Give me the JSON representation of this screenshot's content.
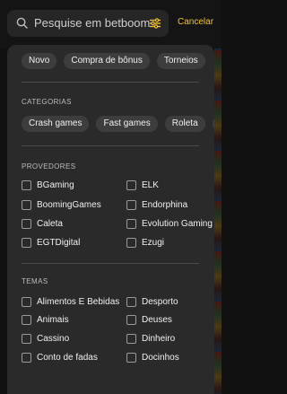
{
  "search": {
    "placeholder": "Pesquise em betboom",
    "cancel_label": "Cancelar"
  },
  "quick_filters": [
    "Novo",
    "Compra de bônus",
    "Torneios"
  ],
  "categories": {
    "title": "CATEGORIAS",
    "items": [
      "Crash games",
      "Fast games",
      "Roleta"
    ]
  },
  "providers": {
    "title": "PROVEDORES",
    "items": [
      "BGaming",
      "ELK",
      "BoomingGames",
      "Endorphina",
      "Caleta",
      "Evolution Gaming",
      "EGTDigital",
      "Ezugi"
    ]
  },
  "themes": {
    "title": "TEMAS",
    "items": [
      "Alimentos E Bebidas",
      "Desporto",
      "Animais",
      "Deuses",
      "Cassino",
      "Dinheiro",
      "Conto de fadas",
      "Docinhos"
    ]
  },
  "colors": {
    "accent": "#f4c430",
    "panel": "#2a2a2a",
    "chip": "#3d3d3d"
  }
}
